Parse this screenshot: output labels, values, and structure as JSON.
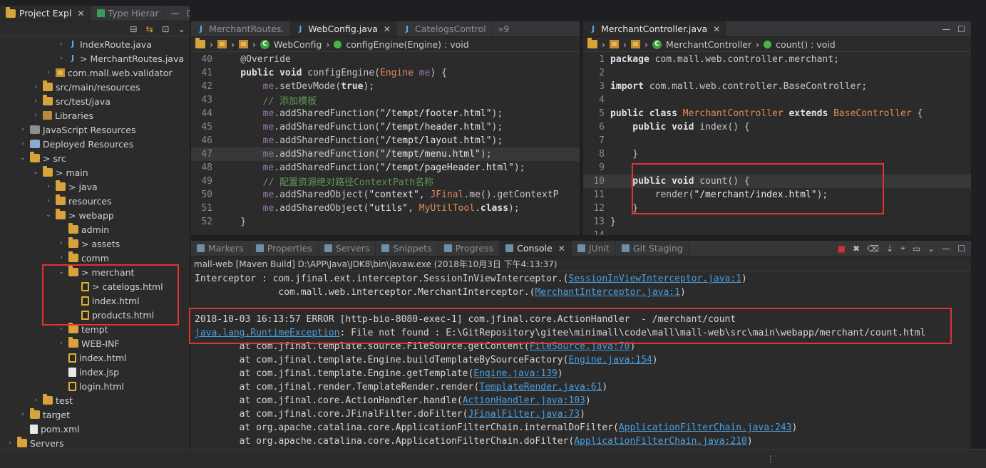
{
  "explorer": {
    "tab_label": "Project Expl",
    "tab2_label": "Type Hierar",
    "items": [
      {
        "label": "IndexRoute.java",
        "indent": 5,
        "tw": "›",
        "icon": "jfile"
      },
      {
        "label": "> MerchantRoutes.java",
        "indent": 5,
        "tw": "›",
        "icon": "jfile"
      },
      {
        "label": "com.mall.web.validator",
        "indent": 4,
        "tw": "›",
        "icon": "pkg"
      },
      {
        "label": "src/main/resources",
        "indent": 3,
        "tw": "›",
        "icon": "folder"
      },
      {
        "label": "src/test/java",
        "indent": 3,
        "tw": "›",
        "icon": "folder"
      },
      {
        "label": "Libraries",
        "indent": 3,
        "tw": "›",
        "icon": "lib"
      },
      {
        "label": "JavaScript Resources",
        "indent": 2,
        "tw": "›",
        "icon": "jsres"
      },
      {
        "label": "Deployed Resources",
        "indent": 2,
        "tw": "›",
        "icon": "deploy"
      },
      {
        "label": "> src",
        "indent": 2,
        "tw": "⌄",
        "icon": "folder"
      },
      {
        "label": "> main",
        "indent": 3,
        "tw": "⌄",
        "icon": "folder"
      },
      {
        "label": "> java",
        "indent": 4,
        "tw": "›",
        "icon": "folder"
      },
      {
        "label": "resources",
        "indent": 4,
        "tw": "›",
        "icon": "folder"
      },
      {
        "label": "> webapp",
        "indent": 4,
        "tw": "⌄",
        "icon": "folder"
      },
      {
        "label": "admin",
        "indent": 5,
        "tw": "",
        "icon": "folder"
      },
      {
        "label": "> assets",
        "indent": 5,
        "tw": "›",
        "icon": "folder"
      },
      {
        "label": "comm",
        "indent": 5,
        "tw": "›",
        "icon": "folder"
      },
      {
        "label": "> merchant",
        "indent": 5,
        "tw": "⌄",
        "icon": "folder"
      },
      {
        "label": "> catelogs.html",
        "indent": 6,
        "tw": "",
        "icon": "html"
      },
      {
        "label": "index.html",
        "indent": 6,
        "tw": "",
        "icon": "html"
      },
      {
        "label": "products.html",
        "indent": 6,
        "tw": "",
        "icon": "html"
      },
      {
        "label": "tempt",
        "indent": 5,
        "tw": "›",
        "icon": "folder"
      },
      {
        "label": "WEB-INF",
        "indent": 5,
        "tw": "›",
        "icon": "folder"
      },
      {
        "label": "index.html",
        "indent": 5,
        "tw": "",
        "icon": "html"
      },
      {
        "label": "index.jsp",
        "indent": 5,
        "tw": "",
        "icon": "xmlf"
      },
      {
        "label": "login.html",
        "indent": 5,
        "tw": "",
        "icon": "html"
      },
      {
        "label": "test",
        "indent": 3,
        "tw": "›",
        "icon": "folder"
      },
      {
        "label": "target",
        "indent": 2,
        "tw": "›",
        "icon": "folder"
      },
      {
        "label": "pom.xml",
        "indent": 2,
        "tw": "",
        "icon": "xmlf"
      },
      {
        "label": "Servers",
        "indent": 1,
        "tw": "›",
        "icon": "folder"
      }
    ]
  },
  "editor1": {
    "tabs": [
      "MerchantRoutes.",
      "WebConfig.java",
      "CatelogsControl",
      "»9"
    ],
    "crumb_class": "WebConfig",
    "crumb_method": "configEngine(Engine) : void",
    "lines": [
      {
        "n": "40",
        "parts": [
          [
            "ann",
            "    @Override"
          ]
        ]
      },
      {
        "n": "41",
        "parts": [
          [
            "kwp",
            "    public "
          ],
          [
            "kwp",
            "void "
          ],
          [
            "fn",
            "configEngine("
          ],
          [
            "cls-ref",
            "Engine "
          ],
          [
            "var",
            "me"
          ],
          [
            "fn",
            ") {"
          ]
        ]
      },
      {
        "n": "42",
        "parts": [
          [
            "var",
            "        me"
          ],
          [
            "fn",
            ".setDevMode("
          ],
          [
            "kwp",
            "true"
          ],
          [
            "fn",
            ");"
          ]
        ]
      },
      {
        "n": "43",
        "parts": [
          [
            "cmt",
            "        // 添加模板"
          ]
        ]
      },
      {
        "n": "44",
        "parts": [
          [
            "var",
            "        me"
          ],
          [
            "fn",
            ".addSharedFunction("
          ],
          [
            "str",
            "\"/tempt/footer.html\""
          ],
          [
            "fn",
            ");"
          ]
        ]
      },
      {
        "n": "45",
        "parts": [
          [
            "var",
            "        me"
          ],
          [
            "fn",
            ".addSharedFunction("
          ],
          [
            "str",
            "\"/tempt/header.html\""
          ],
          [
            "fn",
            ");"
          ]
        ]
      },
      {
        "n": "46",
        "parts": [
          [
            "var",
            "        me"
          ],
          [
            "fn",
            ".addSharedFunction("
          ],
          [
            "str",
            "\"/tempt/layout.html\""
          ],
          [
            "fn",
            ");"
          ]
        ]
      },
      {
        "n": "47",
        "parts": [
          [
            "var",
            "        me"
          ],
          [
            "fn",
            ".addSharedFunction("
          ],
          [
            "str",
            "\"/tempt/menu.html\""
          ],
          [
            "fn",
            ");"
          ]
        ],
        "hl": true
      },
      {
        "n": "48",
        "parts": [
          [
            "var",
            "        me"
          ],
          [
            "fn",
            ".addSharedFunction("
          ],
          [
            "str",
            "\"/tempt/pageHeader.html\""
          ],
          [
            "fn",
            ");"
          ]
        ]
      },
      {
        "n": "49",
        "parts": [
          [
            "cmt",
            "        // 配置资源绝对路径ContextPath名称"
          ]
        ]
      },
      {
        "n": "50",
        "parts": [
          [
            "var",
            "        me"
          ],
          [
            "fn",
            ".addSharedObject("
          ],
          [
            "str",
            "\"context\""
          ],
          [
            "fn",
            ", "
          ],
          [
            "cls-ref",
            "JFinal"
          ],
          [
            "fn",
            ".me().getContextP"
          ]
        ]
      },
      {
        "n": "51",
        "parts": [
          [
            "var",
            "        me"
          ],
          [
            "fn",
            ".addSharedObject("
          ],
          [
            "str",
            "\"utils\""
          ],
          [
            "fn",
            ", "
          ],
          [
            "cls-ref",
            "MyUtilTool"
          ],
          [
            "fn",
            "."
          ],
          [
            "kwp",
            "class"
          ],
          [
            "fn",
            ");"
          ]
        ]
      },
      {
        "n": "52",
        "parts": [
          [
            "fn",
            "    }"
          ]
        ]
      }
    ]
  },
  "editor2": {
    "tab": "MerchantController.java",
    "crumb_class": "MerchantController",
    "crumb_method": "count() : void",
    "lines": [
      {
        "n": "1",
        "parts": [
          [
            "kwp",
            "package "
          ],
          [
            "fn",
            "com.mall.web.controller.merchant;"
          ]
        ]
      },
      {
        "n": "2",
        "parts": []
      },
      {
        "n": "3",
        "parts": [
          [
            "kwp",
            "import "
          ],
          [
            "fn",
            "com.mall.web.controller.BaseController;"
          ]
        ]
      },
      {
        "n": "4",
        "parts": []
      },
      {
        "n": "5",
        "parts": [
          [
            "kwp",
            "public "
          ],
          [
            "kwp",
            "class "
          ],
          [
            "cls-ref",
            "MerchantController "
          ],
          [
            "kwp",
            "extends "
          ],
          [
            "cls-ref",
            "BaseController "
          ],
          [
            "fn",
            "{"
          ]
        ]
      },
      {
        "n": "6",
        "parts": [
          [
            "kwp",
            "    public "
          ],
          [
            "kwp",
            "void "
          ],
          [
            "fn",
            "index() {"
          ]
        ]
      },
      {
        "n": "7",
        "parts": []
      },
      {
        "n": "8",
        "parts": [
          [
            "fn",
            "    }"
          ]
        ]
      },
      {
        "n": "9",
        "parts": []
      },
      {
        "n": "10",
        "parts": [
          [
            "kwp",
            "    public "
          ],
          [
            "kwp",
            "void "
          ],
          [
            "fn",
            "count() {"
          ]
        ],
        "hl": true
      },
      {
        "n": "11",
        "parts": [
          [
            "fn",
            "        render("
          ],
          [
            "str",
            "\"/merchant/index.html\""
          ],
          [
            "fn",
            ");"
          ]
        ]
      },
      {
        "n": "12",
        "parts": [
          [
            "fn",
            "    }"
          ]
        ]
      },
      {
        "n": "13",
        "parts": [
          [
            "fn",
            "}"
          ]
        ]
      },
      {
        "n": "14",
        "parts": []
      }
    ]
  },
  "console": {
    "tabs": [
      "Markers",
      "Properties",
      "Servers",
      "Snippets",
      "Progress",
      "Console",
      "JUnit",
      "Git Staging"
    ],
    "active": "Console",
    "header": "mall-web [Maven Build] D:\\APP\\Java\\JDK8\\bin\\javaw.exe (2018年10月3日 下午4:13:37)",
    "lines": [
      {
        "pre": "Interceptor : com.jfinal.ext.interceptor.SessionInViewInterceptor.(",
        "link": "SessionInViewInterceptor.java:1",
        "post": ")"
      },
      {
        "pre": "               com.mall.web.interceptor.MerchantInterceptor.(",
        "link": "MerchantInterceptor.java:1",
        "post": ")"
      },
      {
        "pre": "",
        "link": "",
        "post": ""
      },
      {
        "pre": "2018-10-03 16:13:57 ERROR [http-bio-8080-exec-1] com.jfinal.core.ActionHandler  - /merchant/count",
        "link": "",
        "post": ""
      },
      {
        "pre": "",
        "link": "java.lang.RuntimeException",
        "post": ": File not found : E:\\GitRepository\\gitee\\minimall\\code\\mall\\mall-web\\src\\main\\webapp/merchant/count.html"
      },
      {
        "pre": "        at com.jfinal.template.source.FileSource.getContent(",
        "link": "FileSource.java:70",
        "post": ")"
      },
      {
        "pre": "        at com.jfinal.template.Engine.buildTemplateBySourceFactory(",
        "link": "Engine.java:154",
        "post": ")"
      },
      {
        "pre": "        at com.jfinal.template.Engine.getTemplate(",
        "link": "Engine.java:139",
        "post": ")"
      },
      {
        "pre": "        at com.jfinal.render.TemplateRender.render(",
        "link": "TemplateRender.java:61",
        "post": ")"
      },
      {
        "pre": "        at com.jfinal.core.ActionHandler.handle(",
        "link": "ActionHandler.java:103",
        "post": ")"
      },
      {
        "pre": "        at com.jfinal.core.JFinalFilter.doFilter(",
        "link": "JFinalFilter.java:73",
        "post": ")"
      },
      {
        "pre": "        at org.apache.catalina.core.ApplicationFilterChain.internalDoFilter(",
        "link": "ApplicationFilterChain.java:243",
        "post": ")"
      },
      {
        "pre": "        at org.apache.catalina.core.ApplicationFilterChain.doFilter(",
        "link": "ApplicationFilterChain.java:210",
        "post": ")"
      }
    ]
  },
  "colors": {
    "highlight_box": "#e03333",
    "accent_link": "#4b9fe0"
  }
}
